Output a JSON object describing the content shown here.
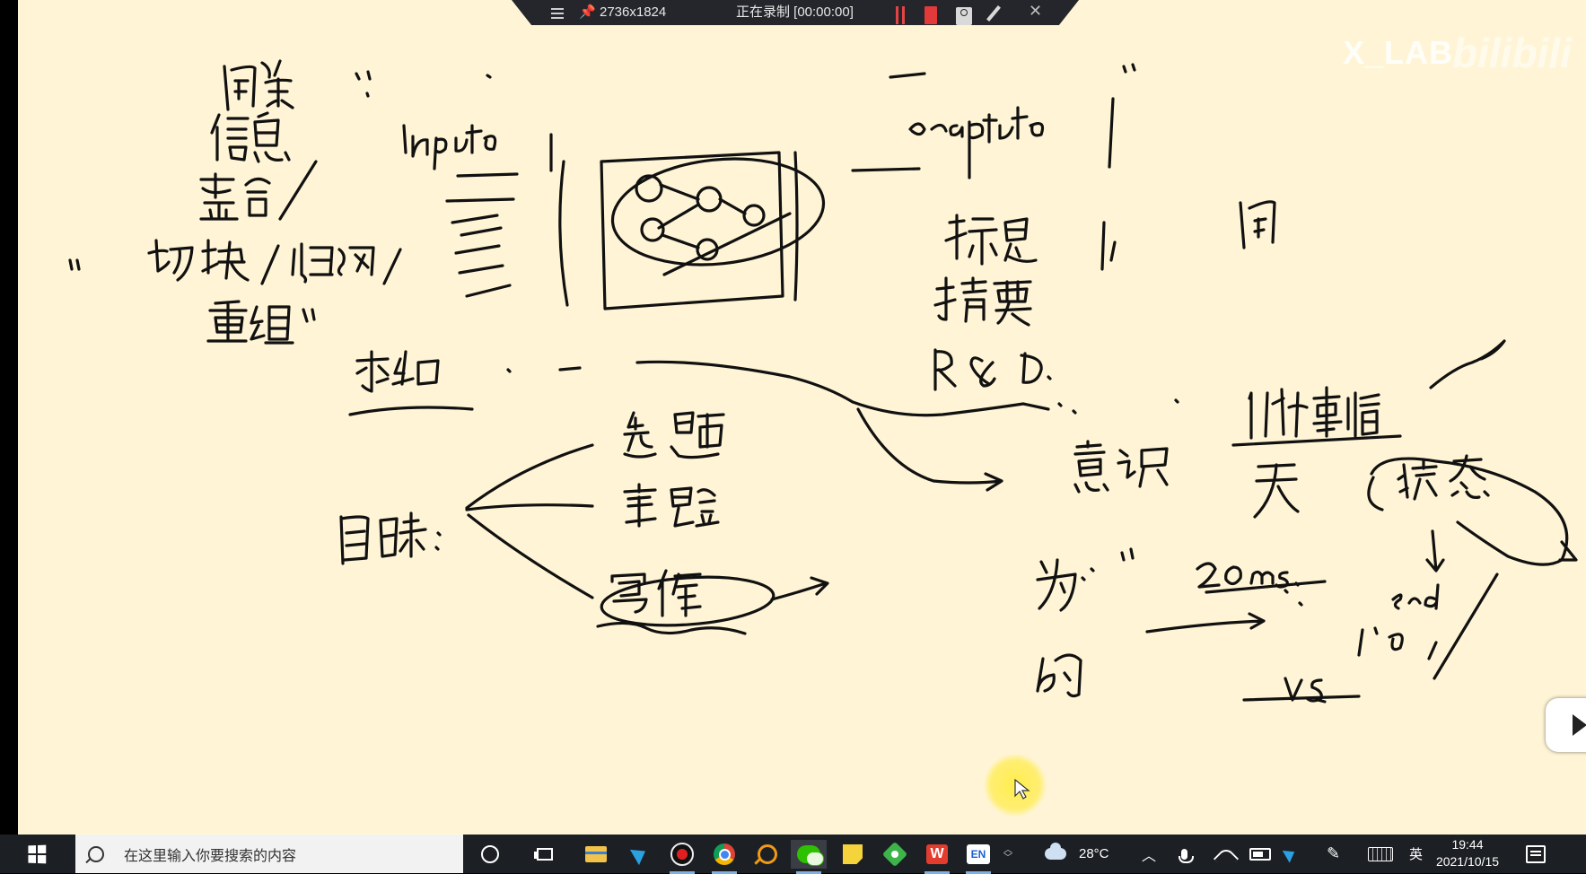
{
  "recorder": {
    "resolution": "2736x1824",
    "status": "正在录制 [00:00:00]"
  },
  "watermark": {
    "lab": "X_LAB",
    "site": "bilibili"
  },
  "whiteboard": {
    "notes": {
      "left_column": [
        "问题",
        "信息",
        "整合/",
        "切块/归纳/",
        "重组"
      ],
      "left_quote_marks": "\"",
      "input_label": "input",
      "output_label": "output",
      "right_items": [
        "标题",
        "摘要",
        "R&D"
      ],
      "far_right_char": "问",
      "bottom_left_label": "求知",
      "goal": "目标",
      "goal_branches": [
        "选题",
        "实验",
        "写作"
      ],
      "middle_label": "意识",
      "event_label": "1个事情",
      "event_sub": "天",
      "state": "状态",
      "measure": "20ms",
      "rows": [
        "为",
        "的"
      ],
      "end_label": "end",
      "vs_label": "vs"
    },
    "background_color": "#fff5d6",
    "ink_color": "#111111"
  },
  "taskbar": {
    "search_placeholder": "在这里输入你要搜索的内容",
    "apps": [
      "cortana-icon",
      "task-view-icon",
      "file-explorer-icon",
      "telegram-icon",
      "recorder-icon",
      "chrome-icon",
      "search-tool-icon",
      "wechat-icon",
      "sticky-notes-icon",
      "green-app-icon",
      "wps-icon",
      "en-input-icon"
    ],
    "weather_temp": "28°C",
    "ime": "英",
    "ime_mode": "EN",
    "time": "19:44",
    "date": "2021/10/15"
  }
}
